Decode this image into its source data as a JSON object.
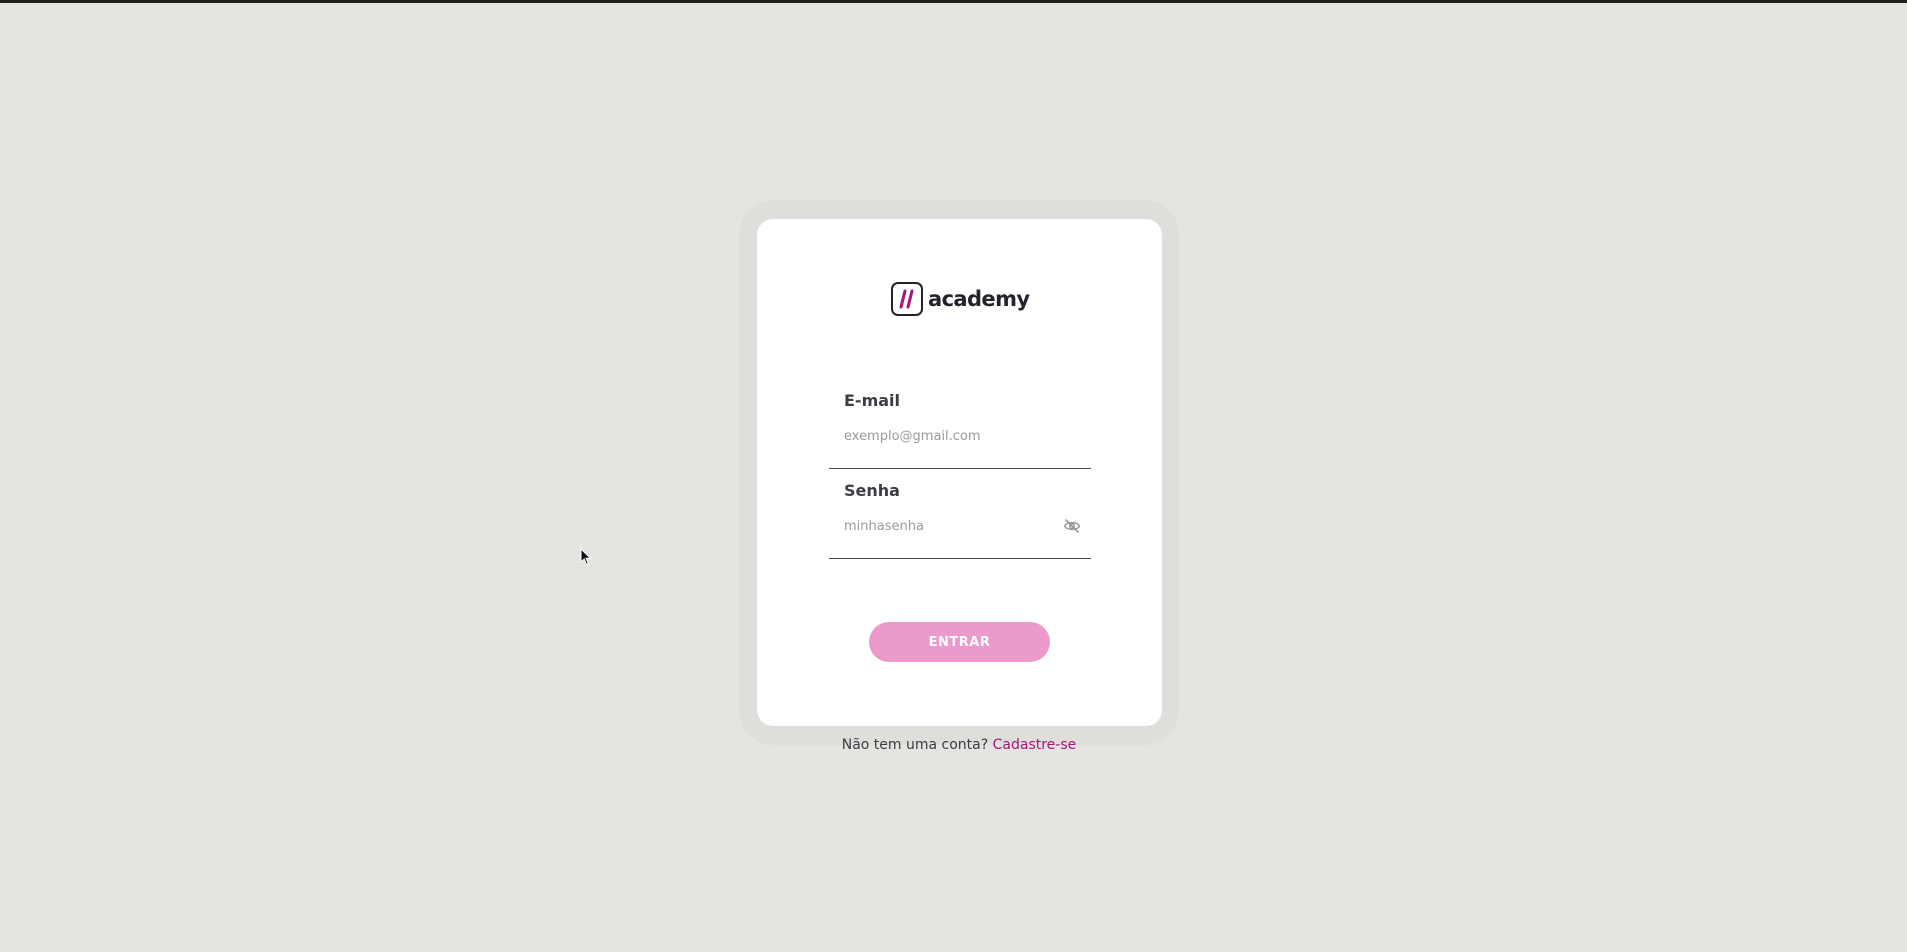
{
  "brand": {
    "name": "academy",
    "logo_icon": "double-slash-logo-icon",
    "accent_color": "#a8147c",
    "dark_color": "#23232e"
  },
  "login_form": {
    "email": {
      "label": "E-mail",
      "value": "",
      "placeholder": "exemplo@gmail.com"
    },
    "password": {
      "label": "Senha",
      "value": "",
      "placeholder": "minhasenha",
      "visibility_icon": "eye-off-icon"
    },
    "submit_label": "ENTRAR",
    "submit_color": "#ec99cb"
  },
  "signup": {
    "prompt": "Não tem uma conta?",
    "link_label": "Cadastre-se"
  }
}
